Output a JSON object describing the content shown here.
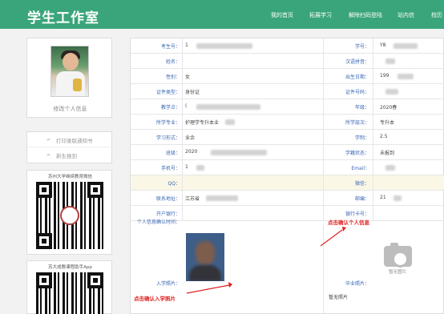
{
  "header": {
    "brand": "学生工作室",
    "nav": [
      "我的首页",
      "拓展学习",
      "解除扫码登陆",
      "站内信",
      "校历"
    ]
  },
  "sidebar": {
    "edit_profile": "修改个人信息",
    "links": [
      {
        "icon": "link-icon",
        "label": "打印录取通知书"
      },
      {
        "icon": "link-icon",
        "label": "新生报到"
      }
    ],
    "qr_cards": [
      {
        "title": "苏州大学继续教育微信"
      },
      {
        "title": "苏大成教课程助手App"
      }
    ]
  },
  "profile_table": {
    "rows": [
      {
        "left_label": "考生号：",
        "left_value": "1",
        "right_label": "学号：",
        "right_value": "Y8"
      },
      {
        "left_label": "姓名：",
        "left_value": "",
        "right_label": "汉语拼音：",
        "right_value": ""
      },
      {
        "left_label": "性别：",
        "left_value": "女",
        "right_label": "出生日期：",
        "right_value": "199"
      },
      {
        "left_label": "证件类型：",
        "left_value": "身份证",
        "right_label": "证件号码：",
        "right_value": ""
      },
      {
        "left_label": "教学点：",
        "left_value": "(",
        "right_label": "年级：",
        "right_value": "2020春"
      },
      {
        "left_label": "所学专业：",
        "left_value": "护理学专升本业",
        "right_label": "所学层次：",
        "right_value": "专升本"
      },
      {
        "left_label": "学习形式：",
        "left_value": "业余",
        "right_label": "学制：",
        "right_value": "2.5"
      },
      {
        "left_label": "班级：",
        "left_value": "2020",
        "right_label": "学籍状态：",
        "right_value": "未报到"
      },
      {
        "left_label": "手机号：",
        "left_value": "1",
        "right_label": "Email：",
        "right_value": ""
      },
      {
        "left_label": "QQ：",
        "left_value": "",
        "right_label": "微信：",
        "right_value": ""
      },
      {
        "left_label": "联系地址：",
        "left_value": "江苏省",
        "right_label": "邮编：",
        "right_value": "21"
      },
      {
        "left_label": "开户银行：",
        "left_value": "",
        "right_label": "银行卡号：",
        "right_value": ""
      }
    ],
    "confirm_label": "个人信息确认时间：",
    "enroll_photo_label": "入学照片：",
    "graduation_photo_label": "毕业照片：",
    "no_photo_icon_caption": "暂无图片",
    "no_photo_text": "暂无照片"
  },
  "annotations": {
    "confirm_info": "点击确认个人信息",
    "confirm_photo": "点击确认入学照片"
  },
  "colors": {
    "header_green": "#3aa57a",
    "label_blue": "#3a67b4",
    "annotation_red": "#e02020"
  }
}
